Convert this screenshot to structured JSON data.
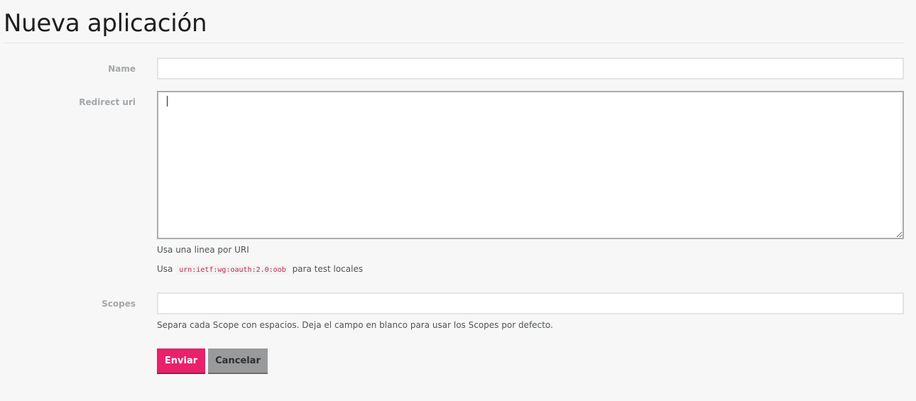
{
  "page": {
    "title": "Nueva aplicación"
  },
  "form": {
    "name": {
      "label": "Name",
      "value": ""
    },
    "redirect_uri": {
      "label": "Redirect uri",
      "value": "",
      "hint_one_line": "Usa una linea por URI",
      "hint_prefix": "Usa",
      "hint_code": "urn:ietf:wg:oauth:2.0:oob",
      "hint_suffix": "para test locales"
    },
    "scopes": {
      "label": "Scopes",
      "value": "",
      "hint": "Separa cada Scope con espacios. Deja el campo en blanco para usar los Scopes por defecto."
    }
  },
  "actions": {
    "submit_label": "Enviar",
    "cancel_label": "Cancelar"
  },
  "colors": {
    "primary": "#e8216a",
    "secondary": "#999a9b",
    "code_text": "#c7254e"
  }
}
